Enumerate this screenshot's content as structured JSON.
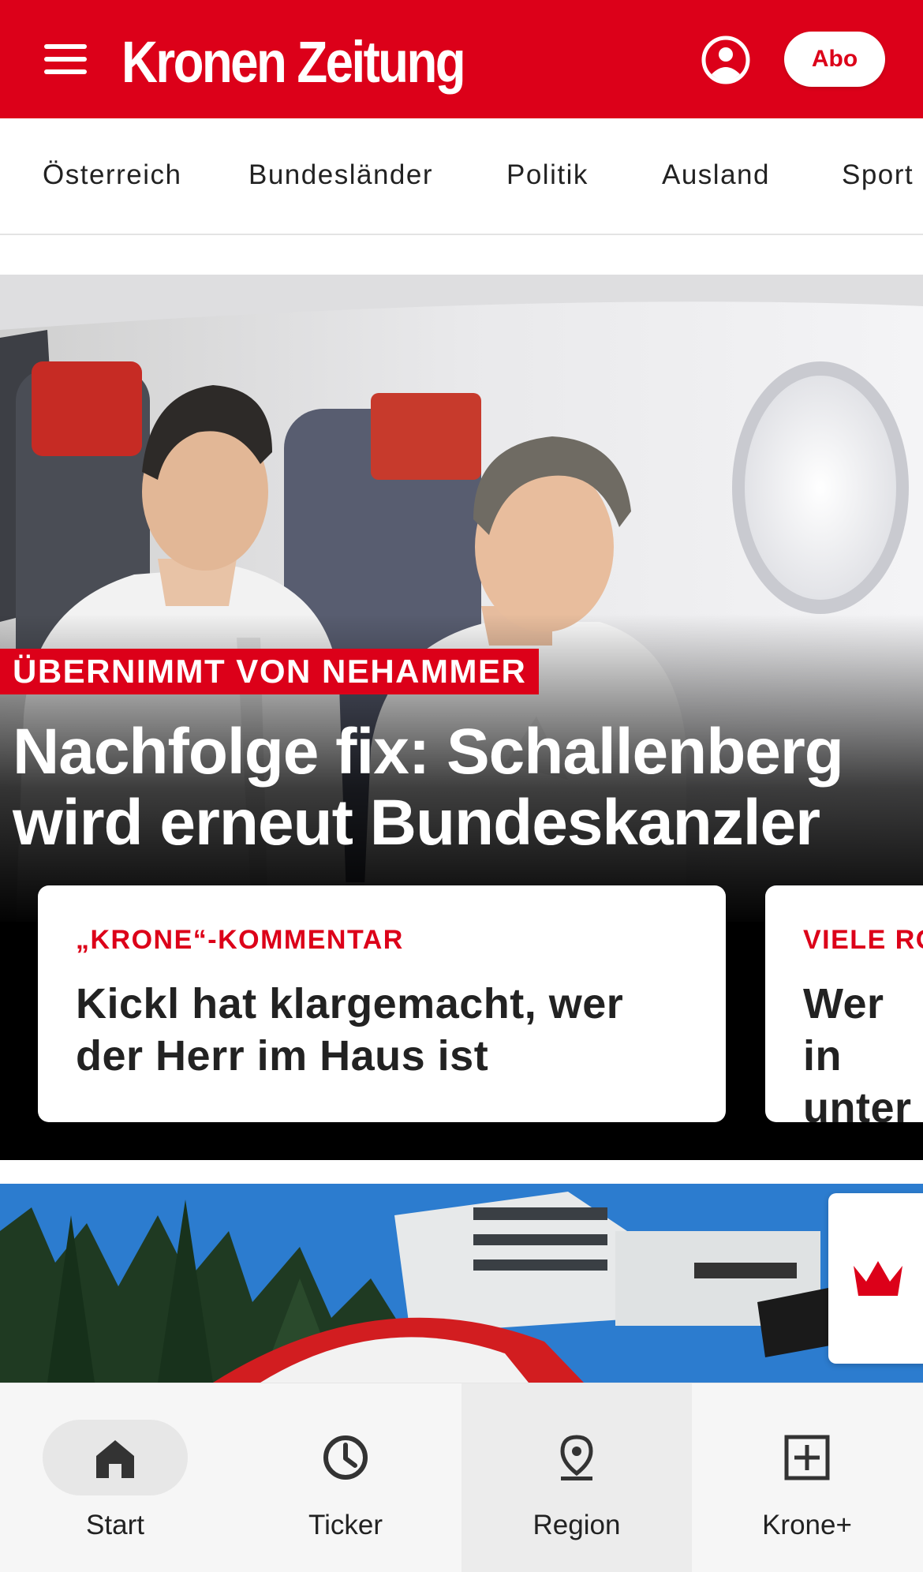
{
  "header": {
    "brand": "Kronen Zeitung",
    "abo_label": "Abo",
    "brand_color": "#dc0019",
    "icons": [
      "menu-icon",
      "account-icon"
    ]
  },
  "categories": [
    {
      "label": "Österreich"
    },
    {
      "label": "Bundesländer"
    },
    {
      "label": "Politik"
    },
    {
      "label": "Ausland"
    },
    {
      "label": "Sport"
    }
  ],
  "hero": {
    "kicker": "ÜBERNIMMT VON NEHAMMER",
    "headline": "Nachfolge fix: Schallenberg wird erneut Bundeskanzler"
  },
  "cards": [
    {
      "kicker": "„KRONE“-KOMMENTAR",
      "title": "Kickl hat klargemacht, wer der Herr im Haus ist"
    },
    {
      "kicker": "VIELE RO",
      "title": "Wer in unter I"
    }
  ],
  "bottom_nav": [
    {
      "label": "Start",
      "icon": "home-icon",
      "active": true
    },
    {
      "label": "Ticker",
      "icon": "clock-icon"
    },
    {
      "label": "Region",
      "icon": "location-pin-icon"
    },
    {
      "label": "Krone+",
      "icon": "plus-square-icon"
    }
  ]
}
